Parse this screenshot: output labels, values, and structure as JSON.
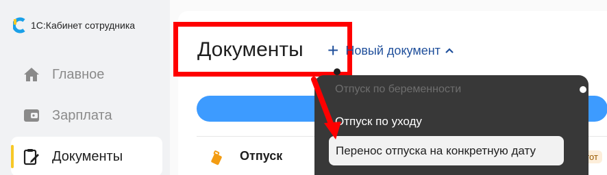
{
  "brand": {
    "name": "1С:Кабинет сотрудника"
  },
  "sidebar": {
    "items": [
      {
        "label": "Главное",
        "icon": "home-icon"
      },
      {
        "label": "Зарплата",
        "icon": "wallet-icon"
      },
      {
        "label": "Документы",
        "icon": "clipboard-edit-icon",
        "active": true
      }
    ]
  },
  "header": {
    "title": "Документы",
    "new_document": "Новый документ"
  },
  "dropdown": {
    "items": [
      {
        "label": "Отпуск по беременности"
      },
      {
        "label": "Отпуск по уходу"
      },
      {
        "label": "Перенос отпуска на конкретную дату",
        "highlighted": true
      }
    ]
  },
  "list": {
    "rows": [
      {
        "label": "Отпуск",
        "badge": "дгот"
      }
    ]
  },
  "colors": {
    "accent": "#3d9bff",
    "link": "#1f4f9b",
    "annotation": "#ff0000",
    "active_marker": "#f7c826",
    "dropdown_bg": "#383838"
  }
}
